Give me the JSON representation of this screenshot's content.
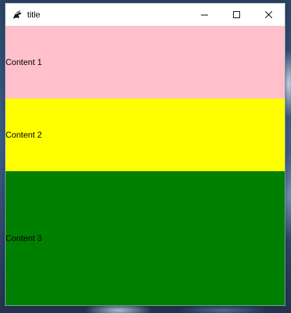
{
  "window": {
    "title": "title",
    "icon": "python-feather-icon",
    "controls": {
      "minimize_icon": "minimize-icon",
      "maximize_icon": "maximize-icon",
      "close_icon": "close-icon"
    }
  },
  "panels": [
    {
      "label": "Content 1",
      "color": "#ffc0cb"
    },
    {
      "label": "Content 2",
      "color": "#ffff00"
    },
    {
      "label": "Content 3",
      "color": "#008000"
    }
  ]
}
